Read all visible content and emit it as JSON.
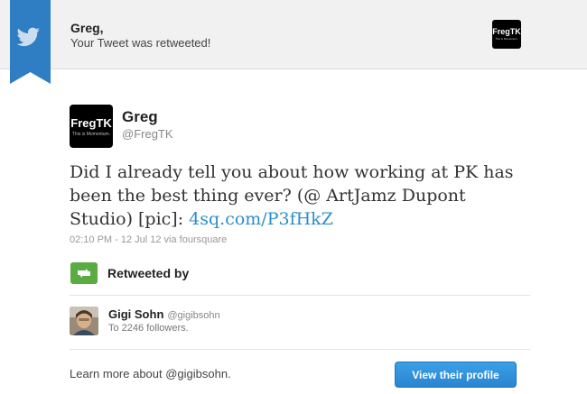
{
  "colors": {
    "ribbon": "#2f7dc3",
    "link": "#2a8ec9",
    "retweet_green": "#5aac42",
    "button_blue": "#2a84d2"
  },
  "notification": {
    "recipient": "Greg,",
    "message": "Your Tweet was retweeted!",
    "icon": "twitter-bird-icon"
  },
  "header_avatar": {
    "text": "FregTK",
    "tagline": "This is Momentum."
  },
  "tweet": {
    "author_name": "Greg",
    "author_handle": "@FregTK",
    "avatar_text": "FregTK",
    "avatar_tagline": "This is Momentum.",
    "text": "Did I already tell you about how working at PK has been the best thing ever? (@ ArtJamz Dupont Studio) [pic]: ",
    "link": "4sq.com/P3fHkZ",
    "meta": "02:10 PM - 12 Jul 12 via foursquare"
  },
  "retweet": {
    "icon": "retweet-icon",
    "label": "Retweeted by"
  },
  "retweeter": {
    "name": "Gigi Sohn",
    "handle": "@gigibsohn",
    "followers": "To 2246 followers."
  },
  "footer": {
    "learn_more": "Learn more about @gigibsohn.",
    "button_label": "View their profile"
  }
}
